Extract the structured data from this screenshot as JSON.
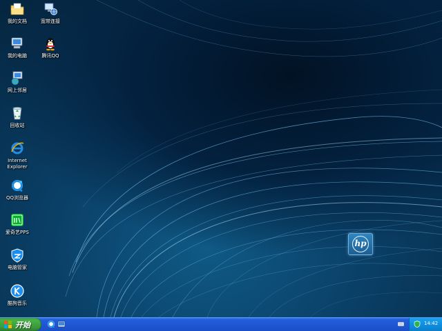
{
  "desktop": {
    "icons": [
      {
        "label": "我的文档",
        "icon": "folder-documents-icon"
      },
      {
        "label": "宽带连接",
        "icon": "network-connection-icon"
      },
      {
        "label": "我的电脑",
        "icon": "computer-icon"
      },
      {
        "label": "腾讯QQ",
        "icon": "qq-penguin-icon"
      },
      {
        "label": "网上邻居",
        "icon": "network-places-icon"
      },
      {
        "label": "回收站",
        "icon": "recycle-bin-icon"
      },
      {
        "label": "Internet\nExplorer",
        "icon": "internet-explorer-icon"
      },
      {
        "label": "QQ浏览器",
        "icon": "qq-browser-icon"
      },
      {
        "label": "爱奇艺PPS",
        "icon": "iqiyi-icon"
      },
      {
        "label": "电脑管家",
        "icon": "pc-manager-shield-icon"
      },
      {
        "label": "酷狗音乐",
        "icon": "kugou-music-icon"
      }
    ],
    "wallpaper_logo": "hp"
  },
  "taskbar": {
    "start_label": "开始",
    "quick_launch": [
      "qq-browser-icon",
      "show-desktop-icon"
    ],
    "tray": {
      "clock": "14:42",
      "icons": [
        "keyboard-icon",
        "pc-manager-shield-icon"
      ]
    }
  },
  "colors": {
    "taskbar_blue": "#245edb",
    "start_green": "#3fa83f",
    "tray_blue": "#0f8fe0",
    "wallpaper_dark": "#021224",
    "wallpaper_light": "#0f5a86"
  }
}
